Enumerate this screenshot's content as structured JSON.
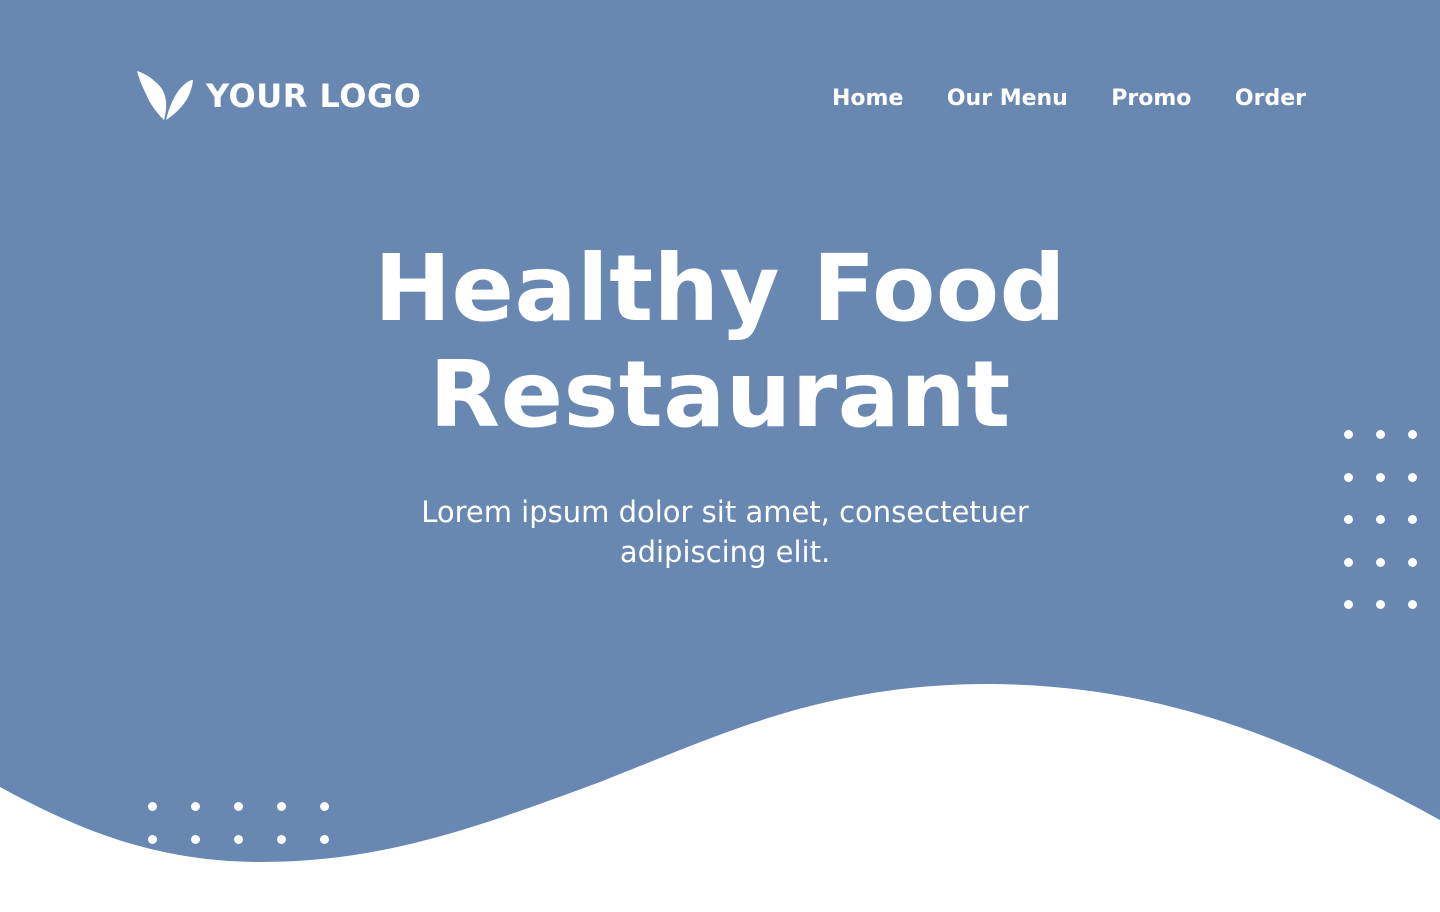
{
  "brand": {
    "logo_text": "YOUR LOGO",
    "logo_icon": "leaf-icon"
  },
  "nav": {
    "items": [
      {
        "label": "Home"
      },
      {
        "label": "Our Menu"
      },
      {
        "label": "Promo"
      },
      {
        "label": "Order"
      }
    ]
  },
  "hero": {
    "title_line1": "Healthy Food",
    "title_line2": "Restaurant",
    "subtitle_line1": "Lorem ipsum dolor sit amet, consectetuer",
    "subtitle_line2": "adipiscing elit."
  },
  "colors": {
    "background": "#6888b2",
    "wave": "#ffffff",
    "text": "#ffffff"
  }
}
